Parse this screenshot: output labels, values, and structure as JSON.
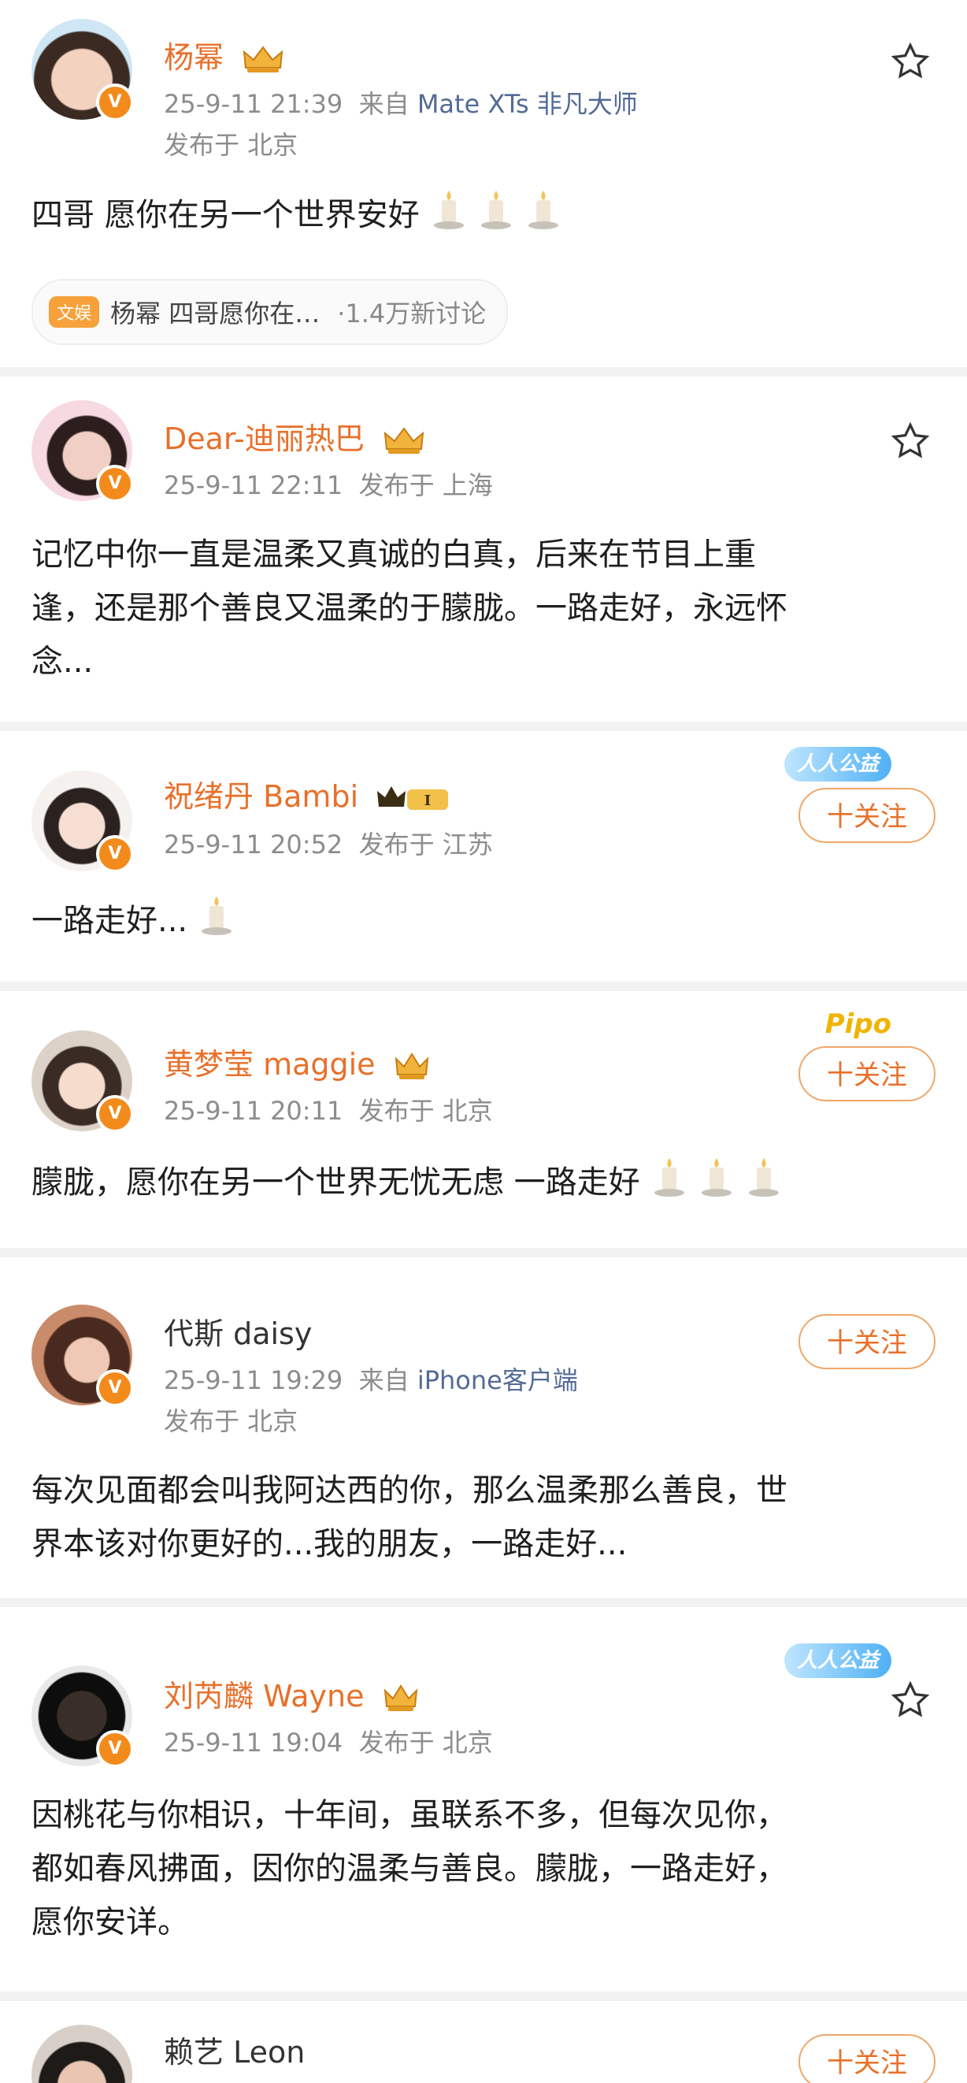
{
  "posts": [
    {
      "name": "杨幂",
      "time": "25-9-11 21:39",
      "source_prefix": "来自",
      "source": "Mate XTs 非凡大师",
      "location": "发布于 北京",
      "text": "四哥 愿你在另一个世界安好",
      "candles": 3,
      "topic": {
        "tag": "文娱",
        "text": "杨幂 四哥愿你在…",
        "count": "·1.4万新讨论"
      }
    },
    {
      "name": "Dear-迪丽热巴",
      "time": "25-9-11 22:11",
      "location": "发布于 上海",
      "text_lines": [
        "记忆中你一直是温柔又真诚的白真，后来在节目上重",
        "逢，还是那个善良又温柔的于朦胧。一路走好，永远怀",
        "念..."
      ]
    },
    {
      "name": "祝绪丹 Bambi",
      "time": "25-9-11 20:52",
      "location": "发布于 江苏",
      "text": "一路走好...",
      "candles": 1,
      "badge": "人人公益",
      "follow": "十关注"
    },
    {
      "name": "黄梦莹 maggie",
      "time": "25-9-11 20:11",
      "location": "发布于 北京",
      "text": "朦胧，愿你在另一个世界无忧无虑 一路走好",
      "candles": 3,
      "badge": "Pipo",
      "follow": "十关注"
    },
    {
      "name": "代斯 daisy",
      "time": "25-9-11 19:29",
      "source_prefix": "来自",
      "source": "iPhone客户端",
      "location": "发布于 北京",
      "text_lines": [
        "每次见面都会叫我阿达西的你，那么温柔那么善良，世",
        "界本该对你更好的...我的朋友，一路走好..."
      ],
      "follow": "十关注"
    },
    {
      "name": "刘芮麟 Wayne",
      "time": "25-9-11 19:04",
      "location": "发布于 北京",
      "text_lines": [
        "因桃花与你相识，十年间，虽联系不多，但每次见你，",
        "都如春风拂面，因你的温柔与善良。朦胧，一路走好，",
        "愿你安详。"
      ],
      "badge": "人人公益"
    },
    {
      "name": "赖艺 Leon",
      "follow": "十关注"
    }
  ],
  "colors": {
    "name_orange": "#e8702a",
    "meta_gray": "#8c8c8c",
    "source_blue": "#536b95",
    "verified": "#f38b1c"
  }
}
